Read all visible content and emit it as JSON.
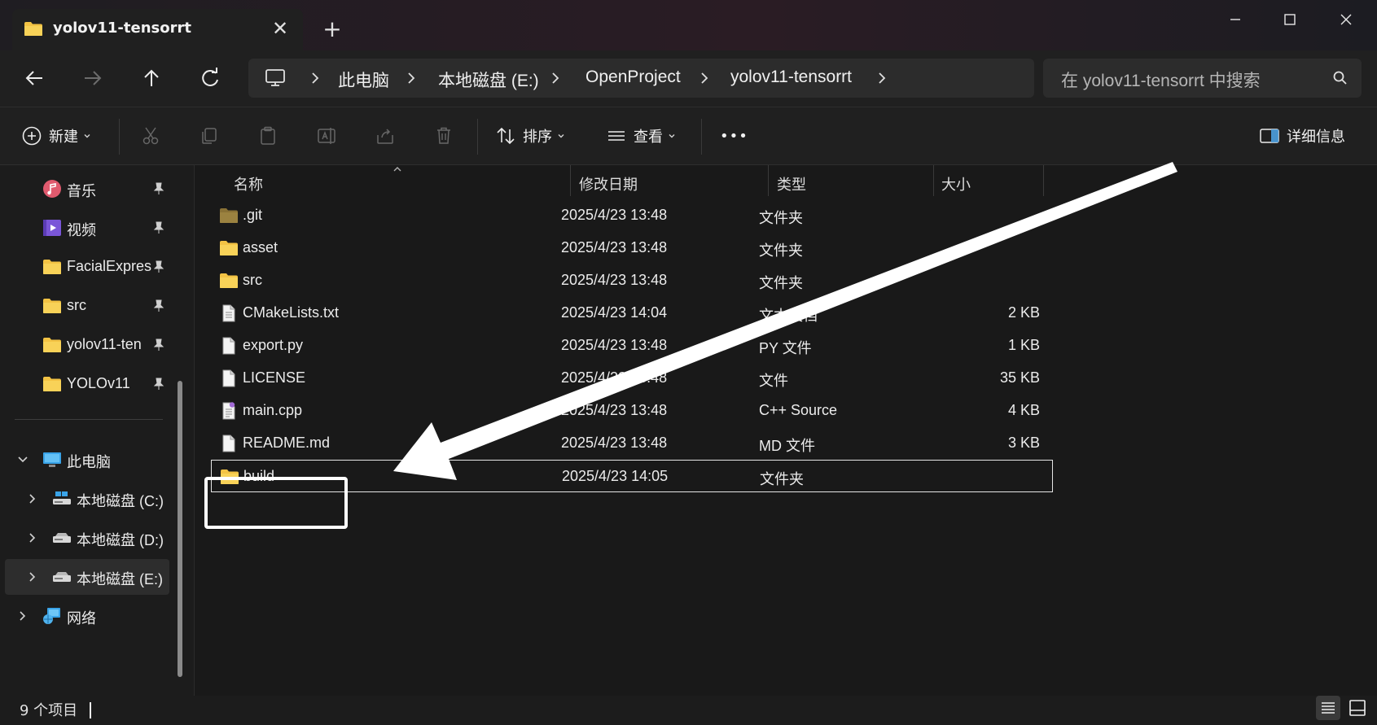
{
  "window": {
    "tab_title": "yolov11-tensorrt"
  },
  "address": {
    "crumbs": [
      "此电脑",
      "本地磁盘 (E:)",
      "OpenProject",
      "yolov11-tensorrt"
    ],
    "search_placeholder": "在 yolov11-tensorrt 中搜索"
  },
  "toolbar": {
    "new_label": "新建",
    "sort_label": "排序",
    "view_label": "查看",
    "more_label": "•••",
    "details_label": "详细信息"
  },
  "sidebar": {
    "quick_access": [
      {
        "label": "音乐",
        "icon": "music-icon"
      },
      {
        "label": "视频",
        "icon": "video-icon"
      },
      {
        "label": "FacialExpres",
        "icon": "folder-icon"
      },
      {
        "label": "src",
        "icon": "folder-icon"
      },
      {
        "label": "yolov11-ten",
        "icon": "folder-icon"
      },
      {
        "label": "YOLOv11",
        "icon": "folder-icon"
      }
    ],
    "this_pc": "此电脑",
    "drives": [
      "本地磁盘 (C:)",
      "本地磁盘 (D:)",
      "本地磁盘 (E:)"
    ],
    "network": "网络"
  },
  "columns": {
    "name": "名称",
    "date": "修改日期",
    "type": "类型",
    "size": "大小"
  },
  "files": [
    {
      "name": ".git",
      "date": "2025/4/23 13:48",
      "type": "文件夹",
      "size": "",
      "icon": "folder-dark-icon"
    },
    {
      "name": "asset",
      "date": "2025/4/23 13:48",
      "type": "文件夹",
      "size": "",
      "icon": "folder-icon"
    },
    {
      "name": "src",
      "date": "2025/4/23 13:48",
      "type": "文件夹",
      "size": "",
      "icon": "folder-icon"
    },
    {
      "name": "CMakeLists.txt",
      "date": "2025/4/23 14:04",
      "type": "文本文档",
      "size": "2 KB",
      "icon": "text-file-icon"
    },
    {
      "name": "export.py",
      "date": "2025/4/23 13:48",
      "type": "PY 文件",
      "size": "1 KB",
      "icon": "file-icon"
    },
    {
      "name": "LICENSE",
      "date": "2025/4/23 13:48",
      "type": "文件",
      "size": "35 KB",
      "icon": "file-icon"
    },
    {
      "name": "main.cpp",
      "date": "2025/4/23 13:48",
      "type": "C++ Source",
      "size": "4 KB",
      "icon": "cpp-file-icon"
    },
    {
      "name": "README.md",
      "date": "2025/4/23 13:48",
      "type": "MD 文件",
      "size": "3 KB",
      "icon": "file-icon"
    },
    {
      "name": "build",
      "date": "2025/4/23 14:05",
      "type": "文件夹",
      "size": "",
      "icon": "folder-icon"
    }
  ],
  "status": {
    "item_count": "9 个项目"
  },
  "colors": {
    "folder": "#f3c344",
    "accent": "#4ca0e0",
    "background": "#191919"
  }
}
